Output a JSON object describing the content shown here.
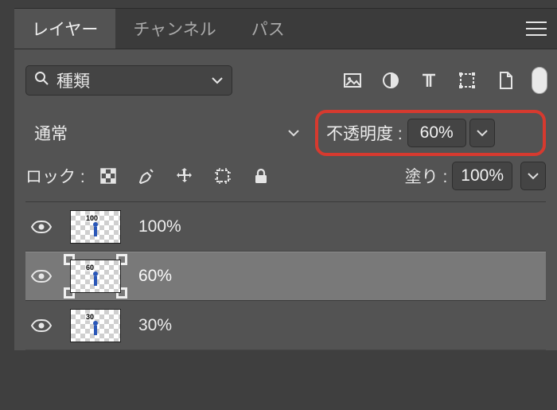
{
  "tabs": {
    "layers": "レイヤー",
    "channels": "チャンネル",
    "paths": "パス"
  },
  "search": {
    "label": "種類"
  },
  "blend": {
    "mode": "通常"
  },
  "opacity": {
    "label": "不透明度 :",
    "value": "60%"
  },
  "lock": {
    "label": "ロック :"
  },
  "fill": {
    "label": "塗り :",
    "value": "100%"
  },
  "layers": [
    {
      "name": "100%",
      "mini": "100"
    },
    {
      "name": "60%",
      "mini": "60"
    },
    {
      "name": "30%",
      "mini": "30"
    }
  ]
}
